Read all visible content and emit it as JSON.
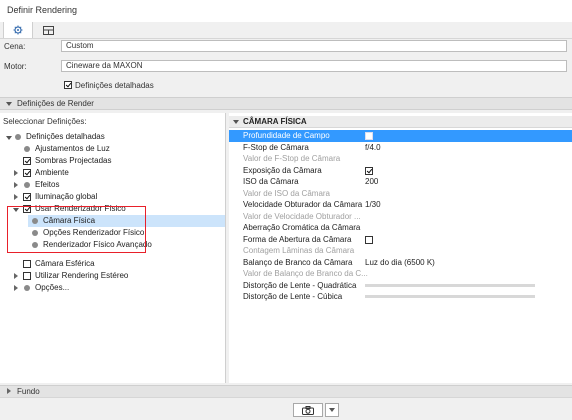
{
  "window": {
    "title": "Definir Rendering"
  },
  "tabs": [
    {
      "icon": "gear-icon"
    },
    {
      "icon": "layout-icon"
    }
  ],
  "scene": {
    "label": "Cena:",
    "value": "Custom"
  },
  "engine": {
    "label": "Motor:",
    "value": "Cineware da MAXON"
  },
  "detailed": {
    "label": "Definições detalhadas",
    "checked": true
  },
  "render_settings": {
    "header": "Definições de Render",
    "select_label": "Seleccionar Definições:"
  },
  "tree": [
    {
      "label": "Definições detalhadas",
      "type": "expanded-root"
    },
    {
      "label": "Ajustamentos de Luz",
      "type": "dot"
    },
    {
      "label": "Sombras Projectadas",
      "type": "checkbox",
      "checked": true
    },
    {
      "label": "Ambiente",
      "type": "collapsed-checkbox",
      "checked": true
    },
    {
      "label": "Efeitos",
      "type": "collapsed-dot"
    },
    {
      "label": "Iluminação global",
      "type": "collapsed-checkbox",
      "checked": true
    },
    {
      "label": "Usar Renderizador Físico",
      "type": "expanded-checkbox",
      "checked": true
    },
    {
      "label": "Câmara Física",
      "type": "sub-dot",
      "selected": true
    },
    {
      "label": "Opções Renderizador Físico",
      "type": "sub-dot"
    },
    {
      "label": "Renderizador Físico Avançado",
      "type": "sub-dot"
    },
    {
      "label": "Câmara Esférica",
      "type": "checkbox",
      "checked": false
    },
    {
      "label": "Utilizar Rendering Estéreo",
      "type": "collapsed-checkbox",
      "checked": false
    },
    {
      "label": "Opções...",
      "type": "collapsed-dot"
    }
  ],
  "props": {
    "header": "CÂMARA FÍSICA",
    "rows": [
      {
        "label": "Profundidade de Campo",
        "value": "",
        "kind": "checkbox",
        "checked": false,
        "state": "highlight"
      },
      {
        "label": "F-Stop de Câmara",
        "value": "f/4.0",
        "kind": "text",
        "state": "normal"
      },
      {
        "label": "Valor de F-Stop de Câmara",
        "value": "",
        "kind": "none",
        "state": "disabled"
      },
      {
        "label": "Exposição da Câmara",
        "value": "",
        "kind": "checkbox",
        "checked": true,
        "state": "normal"
      },
      {
        "label": "ISO da Câmara",
        "value": "200",
        "kind": "text",
        "state": "normal"
      },
      {
        "label": "Valor de ISO da Câmara",
        "value": "",
        "kind": "none",
        "state": "disabled"
      },
      {
        "label": "Velocidade Obturador da Câmara",
        "value": "1/30",
        "kind": "text",
        "state": "normal"
      },
      {
        "label": "Valor de Velocidade Obturador ...",
        "value": "",
        "kind": "none",
        "state": "disabled"
      },
      {
        "label": "Aberração Cromática da Câmara",
        "value": "",
        "kind": "none",
        "state": "normal"
      },
      {
        "label": "Forma de Abertura da Câmara",
        "value": "",
        "kind": "checkbox",
        "checked": false,
        "state": "normal"
      },
      {
        "label": "Contagem Lâminas da Câmara",
        "value": "",
        "kind": "none",
        "state": "disabled"
      },
      {
        "label": "Balanço de Branco da Câmara",
        "value": "Luz do dia (6500 K)",
        "kind": "text",
        "state": "normal"
      },
      {
        "label": "Valor de Balanço de Branco da C...",
        "value": "",
        "kind": "none",
        "state": "disabled"
      },
      {
        "label": "Distorção de Lente - Quadrática",
        "value": "",
        "kind": "slider",
        "level": 0.0,
        "state": "normal"
      },
      {
        "label": "Distorção de Lente - Cúbica",
        "value": "",
        "kind": "slider",
        "level": 0.0,
        "state": "normal"
      }
    ]
  },
  "background": {
    "label": "Fundo"
  },
  "footer": {
    "camera_icon": "camera-icon",
    "dropdown_icon": "chevron-down-icon"
  },
  "colors": {
    "highlight": "#3399ff",
    "annotation_box": "#e8202a"
  }
}
